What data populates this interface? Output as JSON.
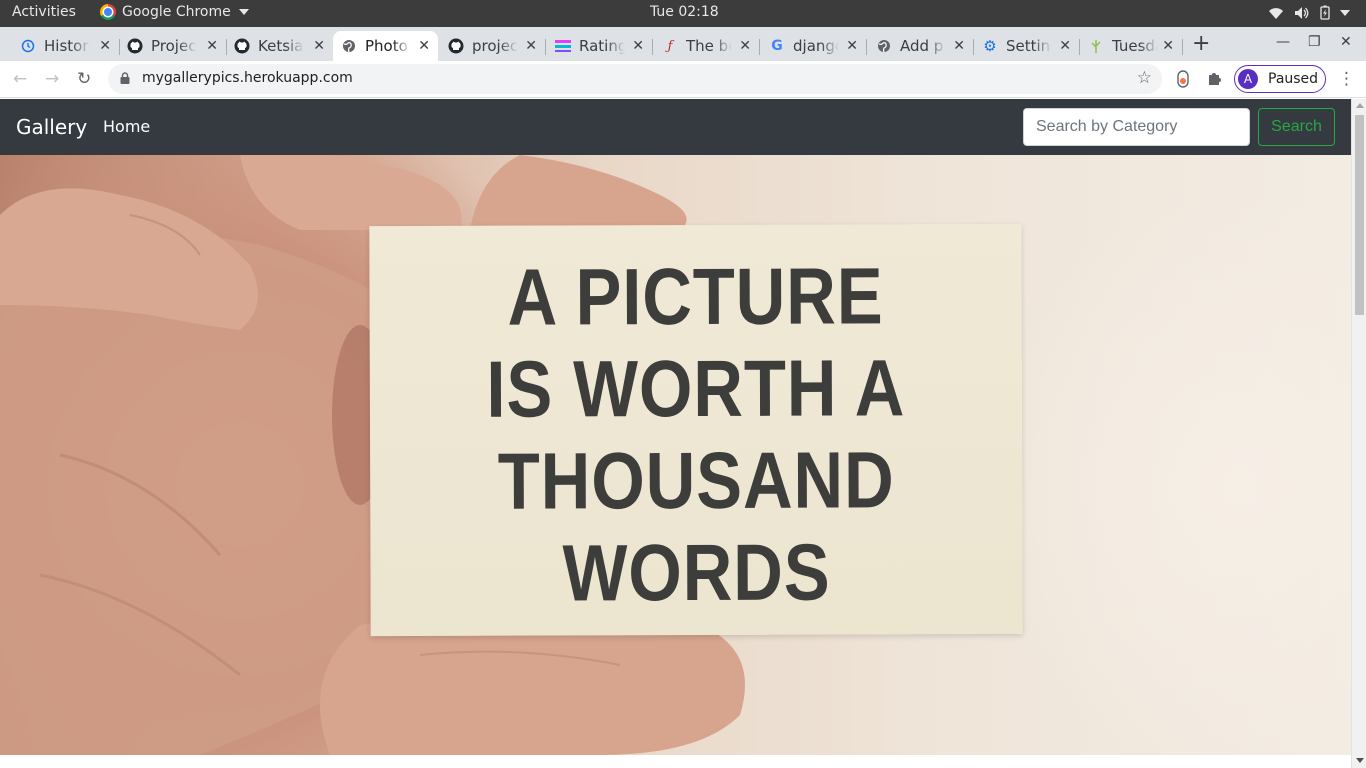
{
  "system_bar": {
    "activities": "Activities",
    "app_name": "Google Chrome",
    "clock": "Tue 02:18"
  },
  "tabs": [
    {
      "label": "History",
      "icon": "history-icon",
      "active": false
    },
    {
      "label": "Project",
      "icon": "github-icon",
      "active": false
    },
    {
      "label": "Ketsia",
      "icon": "github-icon",
      "active": false
    },
    {
      "label": "Photo",
      "icon": "globe-icon",
      "active": true
    },
    {
      "label": "project",
      "icon": "github-icon",
      "active": false
    },
    {
      "label": "Rating",
      "icon": "rating-icon",
      "active": false
    },
    {
      "label": "The best",
      "icon": "function-icon",
      "active": false
    },
    {
      "label": "django",
      "icon": "google-icon",
      "active": false
    },
    {
      "label": "Add p",
      "icon": "globe-icon",
      "active": false
    },
    {
      "label": "Settings",
      "icon": "gear-icon",
      "active": false
    },
    {
      "label": "Tuesday",
      "icon": "tree-icon",
      "active": false
    }
  ],
  "toolbar": {
    "url": "mygallerypics.herokuapp.com",
    "profile_initial": "A",
    "profile_status": "Paused"
  },
  "page": {
    "brand": "Gallery",
    "nav_home": "Home",
    "search_placeholder": "Search by Category",
    "search_button": "Search",
    "hero_lines": [
      "A PICTURE",
      "IS WORTH A",
      "THOUSAND",
      "WORDS"
    ]
  },
  "colors": {
    "navbar_bg": "#343a40",
    "search_button": "#28a745",
    "profile_accent": "#5b2ec2"
  }
}
